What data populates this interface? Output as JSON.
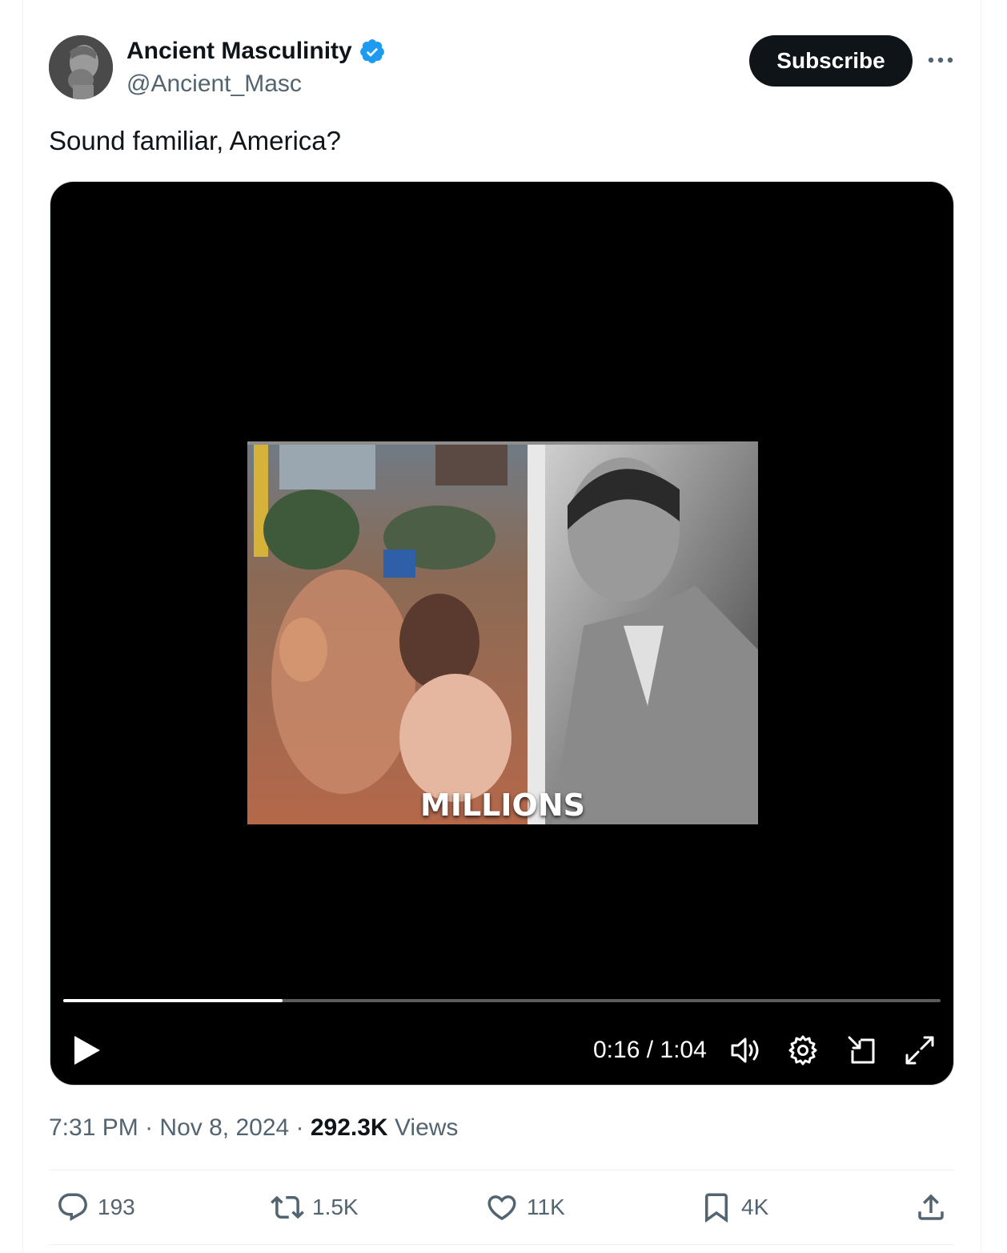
{
  "author": {
    "name": "Ancient Masculinity",
    "handle": "@Ancient_Masc",
    "verified_icon": "verified-badge-icon",
    "avatar_desc": "marble-bust-avatar"
  },
  "header": {
    "subscribe_label": "Subscribe",
    "more_icon": "more-horizontal-icon"
  },
  "tweet": {
    "text": "Sound familiar, America?"
  },
  "video": {
    "caption": "MILLIONS",
    "progress": 0.25,
    "current_time": "0:16",
    "duration": "1:04",
    "time_display": "0:16 / 1:04"
  },
  "meta": {
    "time": "7:31 PM",
    "date": "Nov 8, 2024",
    "views_count": "292.3K",
    "views_label": "Views"
  },
  "actions": {
    "replies": "193",
    "reposts": "1.5K",
    "likes": "11K",
    "bookmarks": "4K"
  },
  "colors": {
    "text_primary": "#0f1419",
    "text_secondary": "#536471",
    "verified_blue": "#1d9bf0",
    "video_bg": "#000000"
  }
}
